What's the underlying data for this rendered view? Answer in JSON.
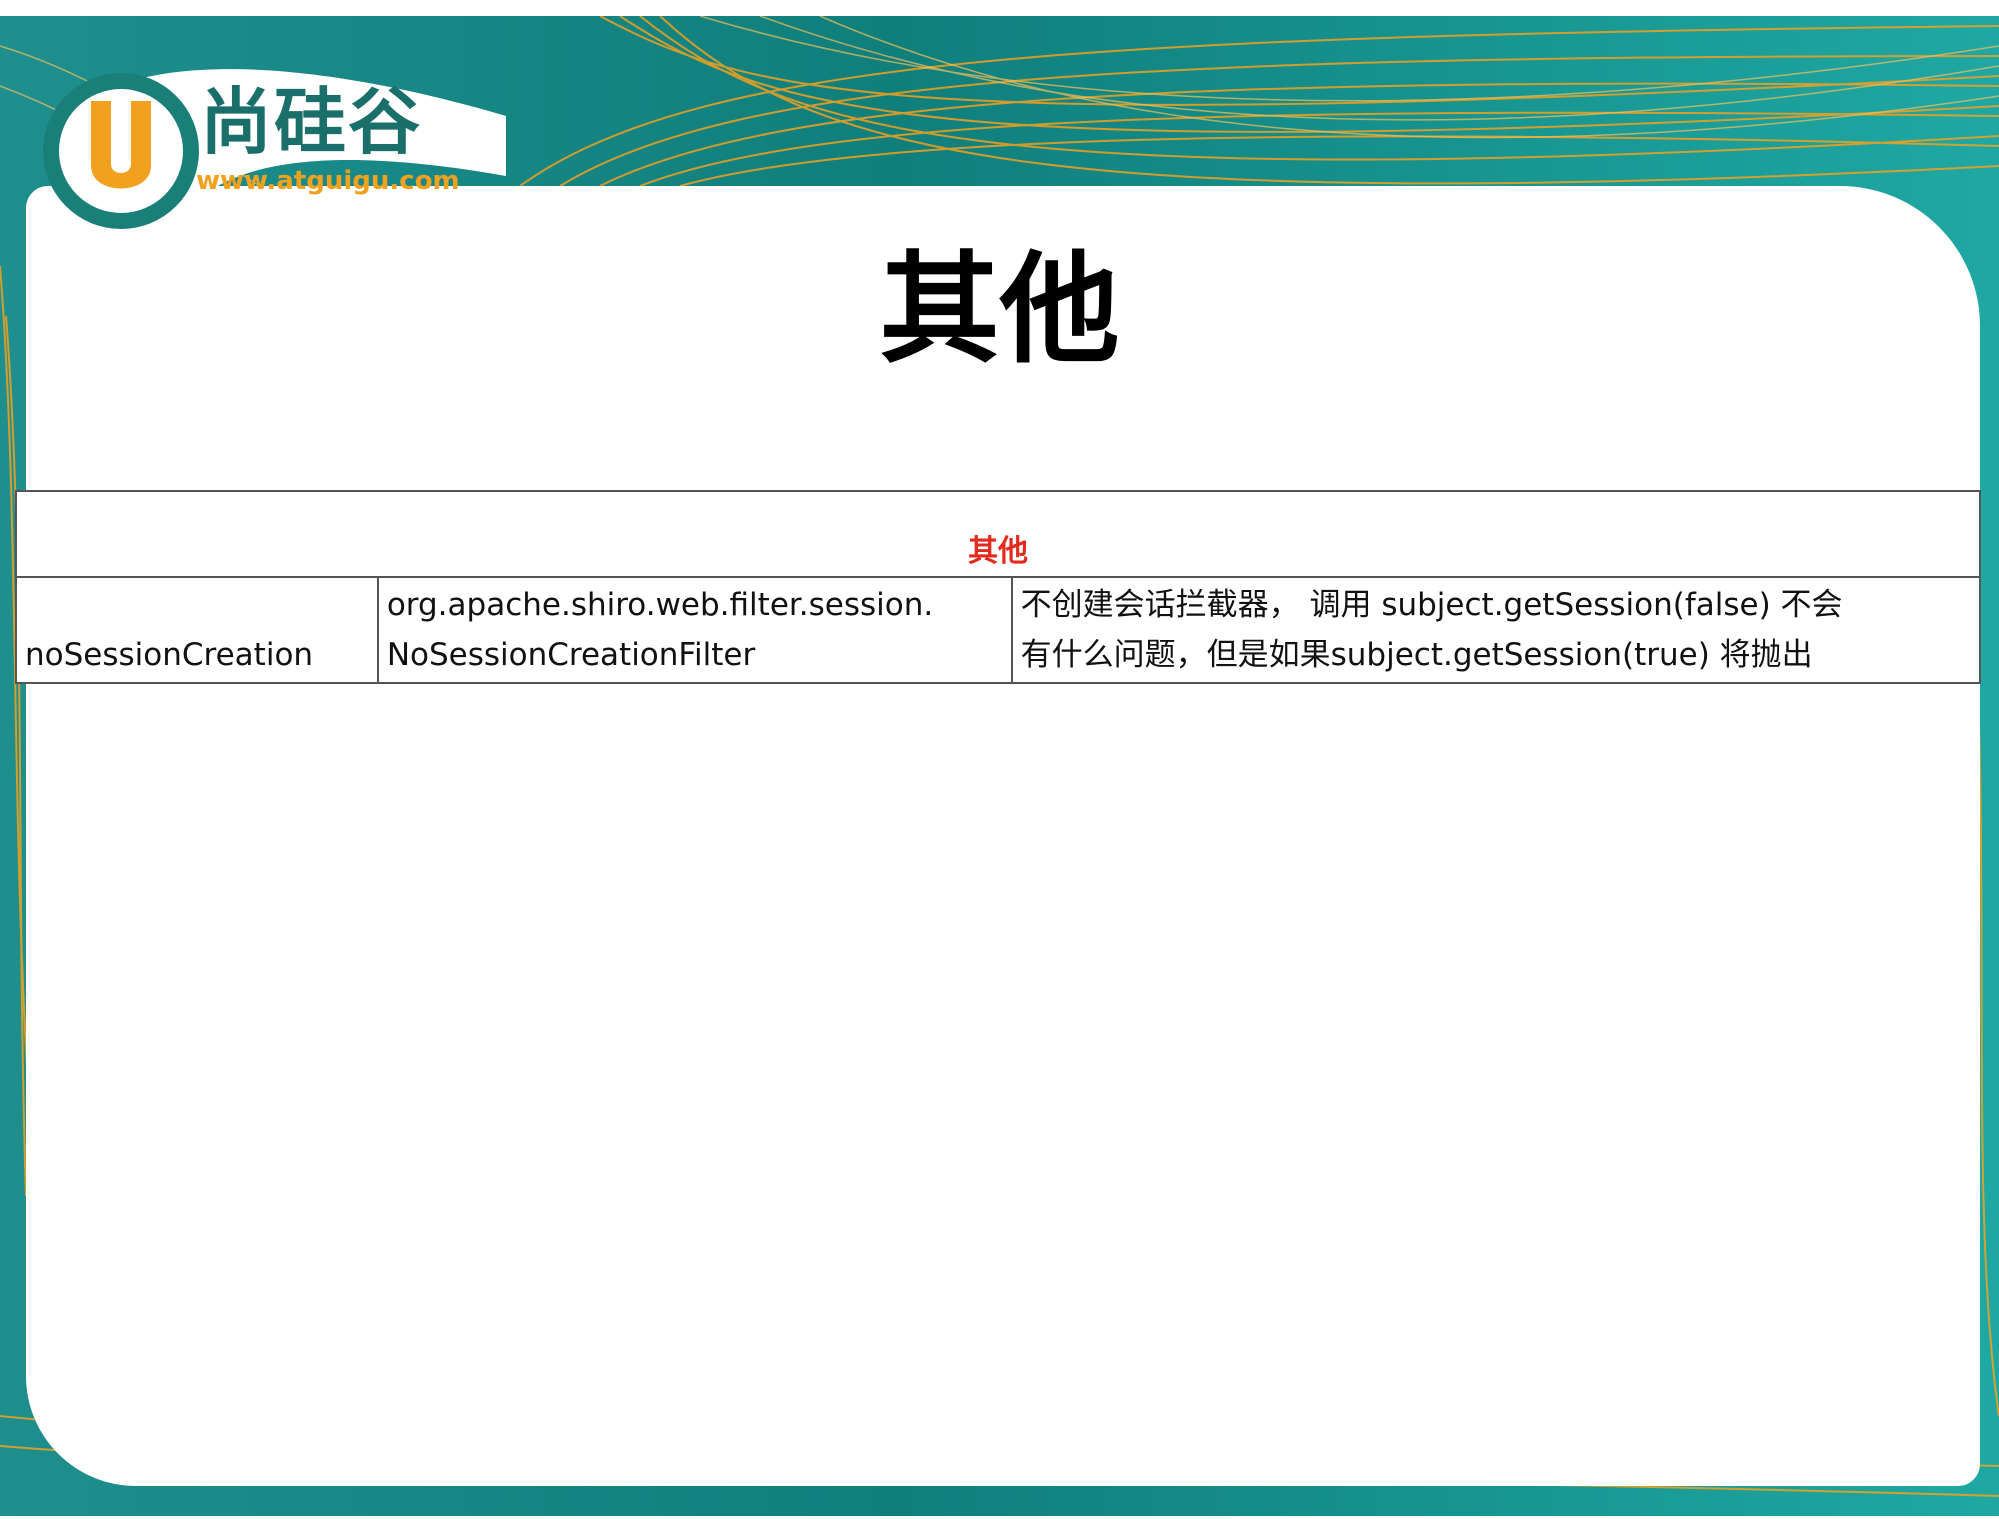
{
  "logo": {
    "letter": "U",
    "brand": "尚硅谷",
    "url": "www.atguigu.com"
  },
  "slide_title": "其他",
  "table": {
    "section_header": "其他",
    "rows": [
      {
        "name": "noSessionCreation",
        "class_lines": [
          "org.apache.shiro.web.filter.session.",
          "NoSessionCreationFilter"
        ],
        "desc_lines": [
          "不创建会话拦截器， 调用 subject.getSession(false) 不会",
          "有什么问题，但是如果subject.getSession(true) 将抛出"
        ]
      }
    ]
  },
  "colors": {
    "teal": "#0f7f7c",
    "orange": "#f2a11f",
    "header_red": "#e32a1f"
  }
}
